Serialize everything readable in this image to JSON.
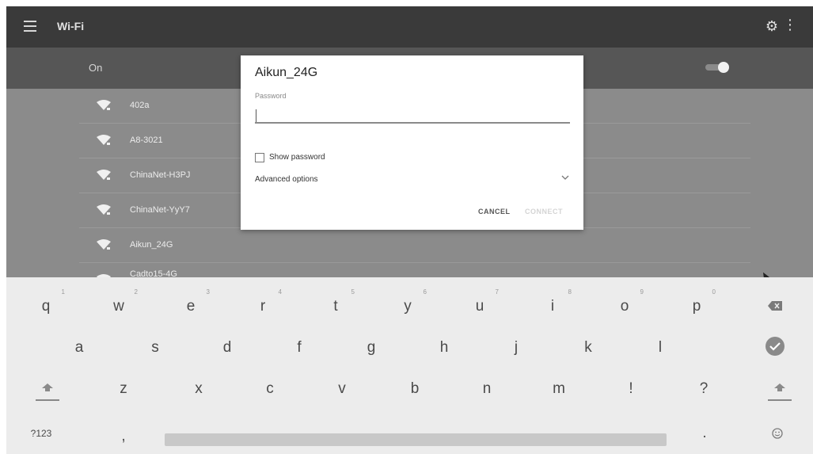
{
  "appbar": {
    "title": "Wi-Fi",
    "menu_icon": "hamburger-menu-icon",
    "settings_icon": "gear-icon",
    "overflow_icon": "more-vert-icon"
  },
  "wifi_toggle": {
    "label": "On",
    "state": "on"
  },
  "networks": [
    {
      "name": "402a"
    },
    {
      "name": "A8-3021"
    },
    {
      "name": "ChinaNet-H3PJ"
    },
    {
      "name": "ChinaNet-YyY7"
    },
    {
      "name": "Aikun_24G"
    },
    {
      "name": "Cadto15-4G"
    }
  ],
  "dialog": {
    "title": "Aikun_24G",
    "password_label": "Password",
    "password_value": "",
    "show_password_label": "Show password",
    "show_password_checked": false,
    "advanced_label": "Advanced options",
    "cancel_label": "CANCEL",
    "connect_label": "CONNECT"
  },
  "keyboard": {
    "row1": [
      {
        "ch": "q",
        "hint": "1"
      },
      {
        "ch": "w",
        "hint": "2"
      },
      {
        "ch": "e",
        "hint": "3"
      },
      {
        "ch": "r",
        "hint": "4"
      },
      {
        "ch": "t",
        "hint": "5"
      },
      {
        "ch": "y",
        "hint": "6"
      },
      {
        "ch": "u",
        "hint": "7"
      },
      {
        "ch": "i",
        "hint": "8"
      },
      {
        "ch": "o",
        "hint": "9"
      },
      {
        "ch": "p",
        "hint": "0"
      }
    ],
    "row2": [
      "a",
      "s",
      "d",
      "f",
      "g",
      "h",
      "j",
      "k",
      "l"
    ],
    "row3": [
      "z",
      "x",
      "c",
      "v",
      "b",
      "n",
      "m",
      "!",
      "?"
    ],
    "symbols_label": "?123",
    "comma": ",",
    "period": ".",
    "backspace_icon": "backspace-icon",
    "enter_icon": "check-circle-icon",
    "shift_icon": "shift-arrow-icon",
    "emoji_icon": "emoji-icon"
  }
}
